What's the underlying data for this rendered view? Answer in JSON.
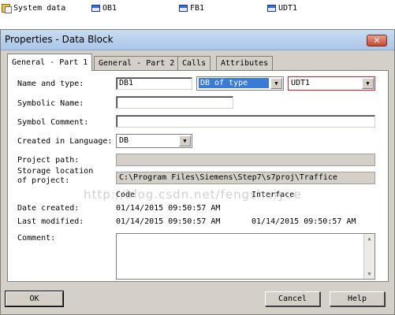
{
  "background_window": {
    "items": [
      {
        "label": "System data",
        "icon": "system-data-icon"
      },
      {
        "label": "OB1",
        "icon": "block-icon"
      },
      {
        "label": "FB1",
        "icon": "block-icon"
      },
      {
        "label": "UDT1",
        "icon": "block-icon"
      }
    ]
  },
  "dialog": {
    "title": "Properties - Data Block",
    "close_glyph": "✕"
  },
  "tabs": [
    {
      "label": "General - Part 1",
      "active": true
    },
    {
      "label": "General - Part 2",
      "active": false
    },
    {
      "label": "Calls",
      "active": false
    },
    {
      "label": "Attributes",
      "active": false
    }
  ],
  "form": {
    "name_and_type_label": "Name and type:",
    "name_value": "DB1",
    "type_value": "DB of type",
    "udt_value": "UDT1",
    "symbolic_name_label": "Symbolic Name:",
    "symbolic_name_value": "",
    "symbol_comment_label": "Symbol Comment:",
    "symbol_comment_value": "",
    "created_in_language_label": "Created in Language:",
    "language_value": "DB",
    "project_path_label": "Project path:",
    "project_path_value": "",
    "storage_location_label_line1": "Storage location",
    "storage_location_label_line2": "of project:",
    "storage_location_value": "C:\\Program Files\\Siemens\\Step7\\s7proj\\Traffice",
    "code_header": "Code",
    "interface_header": "Interface",
    "date_created_label": "Date created:",
    "date_created_code": "01/14/2015 09:50:57 AM",
    "last_modified_label": "Last modified:",
    "last_modified_code": "01/14/2015 09:50:57 AM",
    "last_modified_interface": "01/14/2015 09:50:57 AM",
    "comment_label": "Comment:",
    "comment_value": ""
  },
  "watermark": "http://blog.csdn.net/fengshuiyue",
  "buttons": {
    "ok": "OK",
    "cancel": "Cancel",
    "help": "Help"
  },
  "colors": {
    "titlebar": "#aac6e8",
    "dialog_face": "#d4d0c8",
    "selection": "#3a7bd5",
    "udt_border": "#c8202a",
    "close_button": "#c8462c"
  }
}
